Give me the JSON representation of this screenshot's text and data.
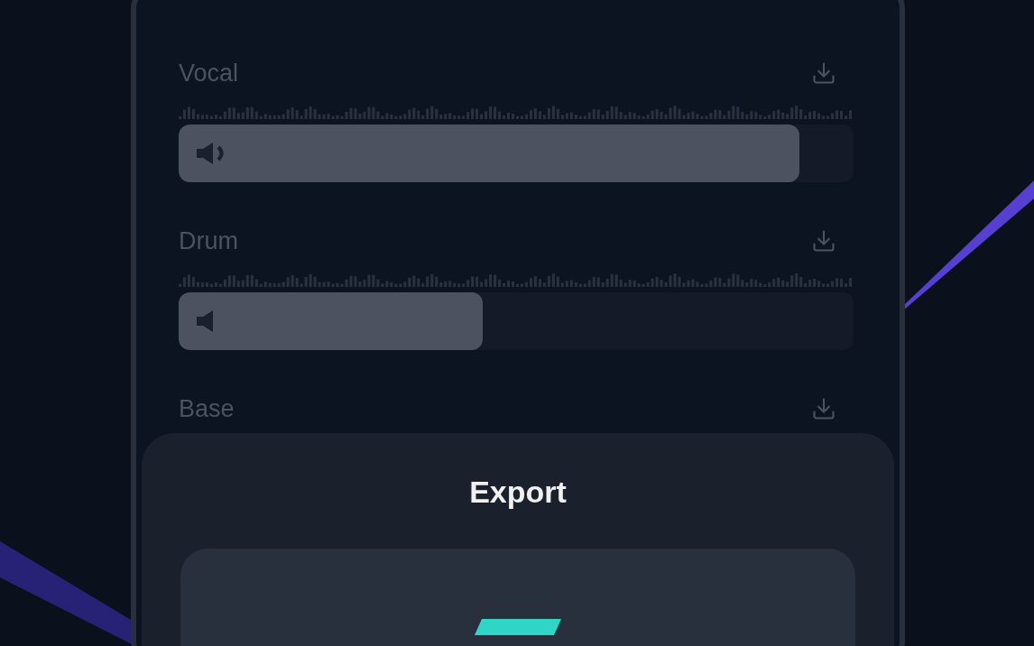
{
  "tracks": [
    {
      "name": "Vocal",
      "level": 0.92
    },
    {
      "name": "Drum",
      "level": 0.45
    },
    {
      "name": "Base"
    }
  ],
  "export_sheet": {
    "title": "Export"
  }
}
